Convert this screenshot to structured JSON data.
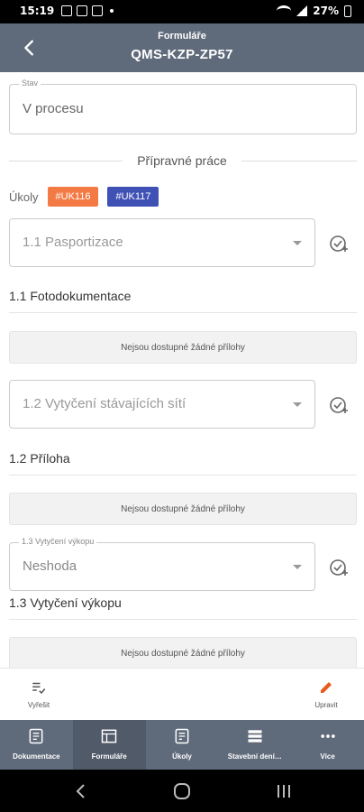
{
  "status_bar": {
    "time": "15:19",
    "battery": "27%"
  },
  "header": {
    "subtitle": "Formuláře",
    "title": "QMS-KZP-ZP57"
  },
  "stav": {
    "label": "Stav",
    "value": "V procesu"
  },
  "section": {
    "title": "Přípravné práce"
  },
  "ukoly": {
    "label": "Úkoly",
    "tags": [
      "#UK116",
      "#UK117"
    ],
    "tag_colors": [
      "#f47a45",
      "#3f51b5"
    ]
  },
  "items": [
    {
      "select_value": "1.1 Pasportizace",
      "heading": "1.1 Fotodokumentace",
      "empty_text": "Nejsou dostupné žádné přílohy"
    },
    {
      "select_value": "1.2 Vytyčení stávajících sítí",
      "heading": "1.2 Příloha",
      "empty_text": "Nejsou dostupné žádné přílohy"
    },
    {
      "select_label": "1.3 Vytyčení výkopu",
      "select_value": "Neshoda",
      "heading": "1.3 Vytyčení výkopu",
      "empty_text": "Nejsou dostupné žádné přílohy"
    }
  ],
  "actions": {
    "resolve": "Vyřešit",
    "edit": "Upravit",
    "edit_color": "#e85a1e"
  },
  "bottom_nav": [
    {
      "label": "Dokumentace",
      "icon": "document-icon"
    },
    {
      "label": "Formuláře",
      "icon": "form-icon"
    },
    {
      "label": "Úkoly",
      "icon": "task-icon"
    },
    {
      "label": "Stavební dení…",
      "icon": "diary-icon"
    },
    {
      "label": "Více",
      "icon": "more-icon"
    }
  ]
}
